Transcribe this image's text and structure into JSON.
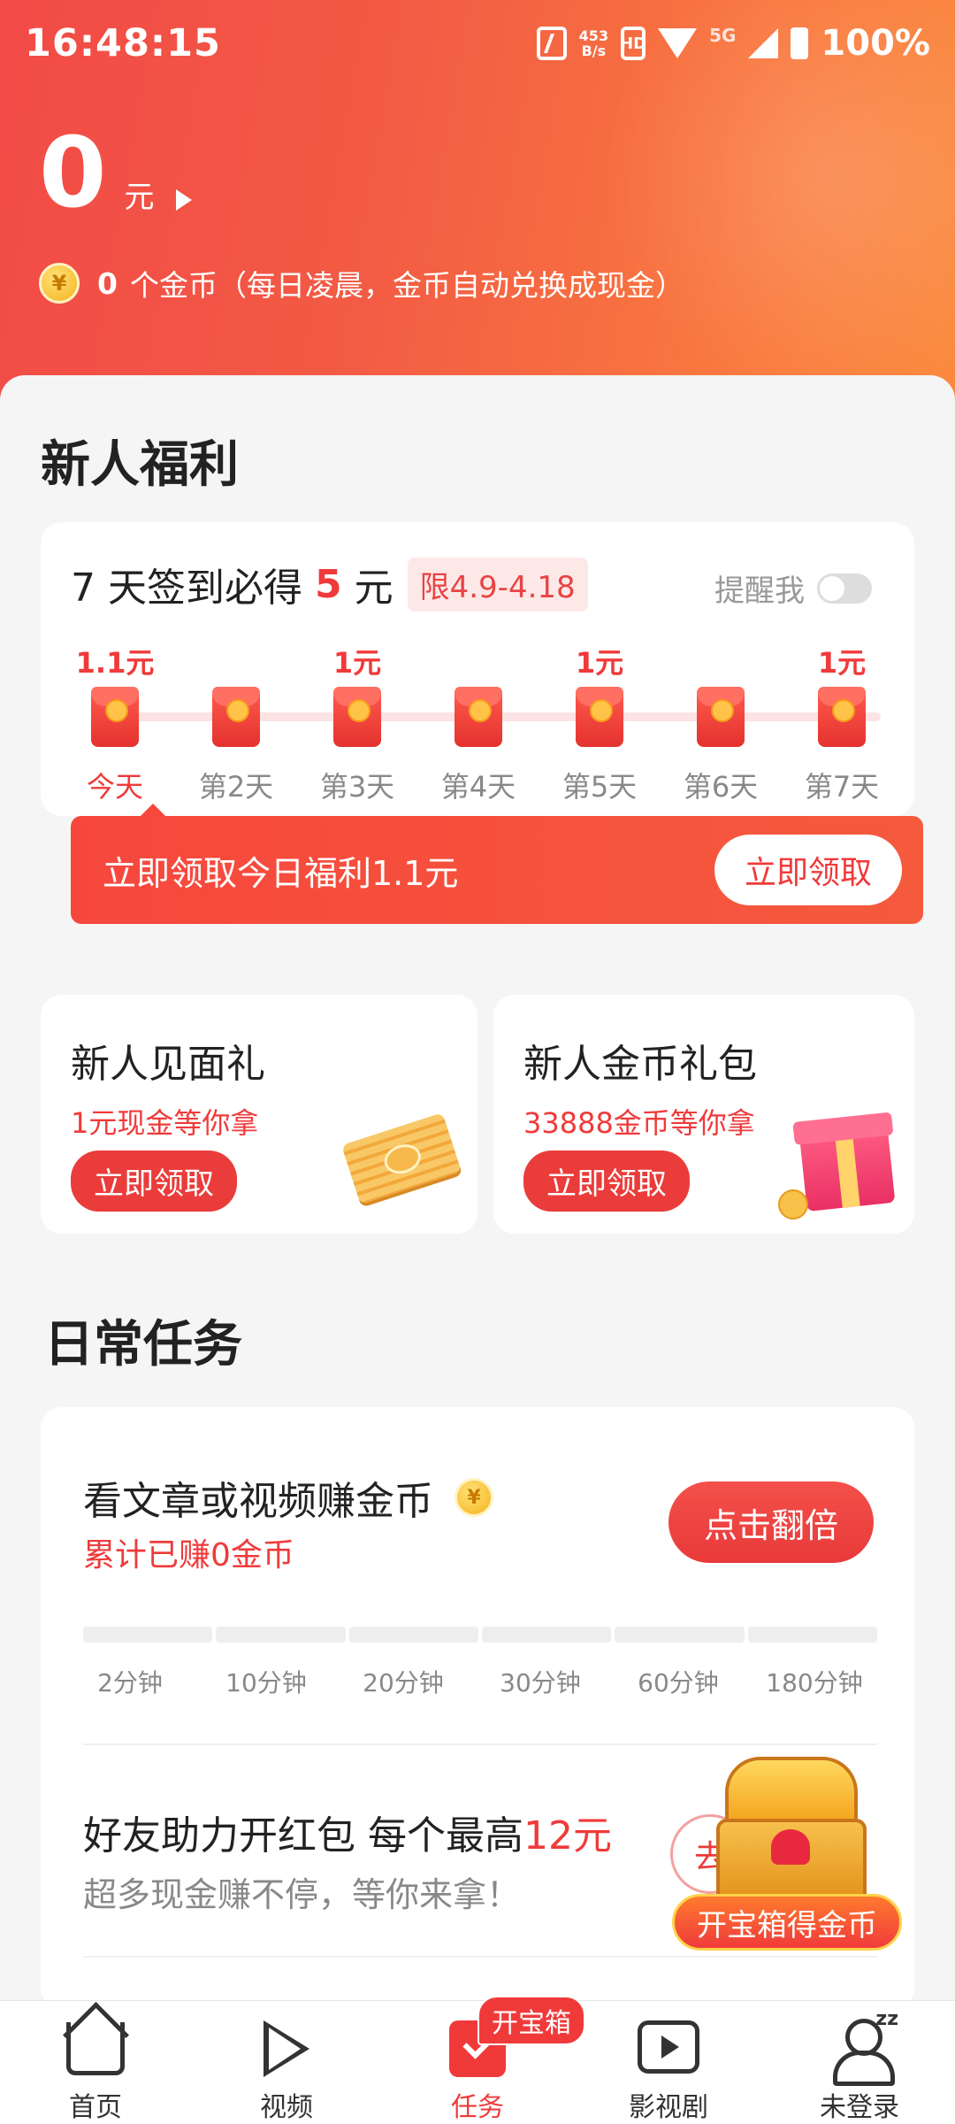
{
  "status_bar": {
    "time": "16:48:15",
    "net_speed": "453",
    "net_unit": "B/s",
    "hd": "HD",
    "network": "5G",
    "battery": "100%"
  },
  "header": {
    "balance": "0",
    "balance_unit": "元",
    "coin_count": "0",
    "coin_text": "个金币（每日凌晨，金币自动兑换成现金）",
    "coin_symbol": "¥"
  },
  "newcomer": {
    "title": "新人福利",
    "signin": {
      "prefix": "7 天签到必得",
      "amount": "5",
      "unit": "元",
      "limit_tag": "限4.9-4.18",
      "remind_label": "提醒我",
      "remind_on": false,
      "days": [
        {
          "reward": "1.1元",
          "label": "今天"
        },
        {
          "reward": "",
          "label": "第2天"
        },
        {
          "reward": "1元",
          "label": "第3天"
        },
        {
          "reward": "",
          "label": "第4天"
        },
        {
          "reward": "1元",
          "label": "第5天"
        },
        {
          "reward": "",
          "label": "第6天"
        },
        {
          "reward": "1元",
          "label": "第7天"
        }
      ],
      "claim_text": "立即领取今日福利1.1元",
      "claim_button": "立即领取"
    },
    "gifts": [
      {
        "title": "新人见面礼",
        "subtitle": "1元现金等你拿",
        "button": "立即领取"
      },
      {
        "title": "新人金币礼包",
        "subtitle": "33888金币等你拿",
        "button": "立即领取"
      }
    ]
  },
  "daily": {
    "title": "日常任务",
    "watch_task": {
      "title": "看文章或视频赚金币",
      "earned": "累计已赚0金币",
      "button": "点击翻倍",
      "milestones": [
        "2分钟",
        "10分钟",
        "20分钟",
        "30分钟",
        "60分钟",
        "180分钟"
      ]
    },
    "friend_task": {
      "title_prefix": "好友助力开红包 每个最高",
      "title_amount": "12元",
      "subtitle": "超多现金赚不停，等你来拿！",
      "button": "去"
    }
  },
  "treasure": {
    "label": "开宝箱得金币"
  },
  "nav": {
    "items": [
      {
        "label": "首页",
        "icon": "home-icon"
      },
      {
        "label": "视频",
        "icon": "play-icon"
      },
      {
        "label": "任务",
        "icon": "task-icon",
        "active": true,
        "badge": "开宝箱"
      },
      {
        "label": "影视剧",
        "icon": "tv-icon"
      },
      {
        "label": "未登录",
        "icon": "user-icon"
      }
    ]
  },
  "colors": {
    "accent": "#f03a3a",
    "header_start": "#f24a47",
    "header_end": "#fb8a3d"
  }
}
